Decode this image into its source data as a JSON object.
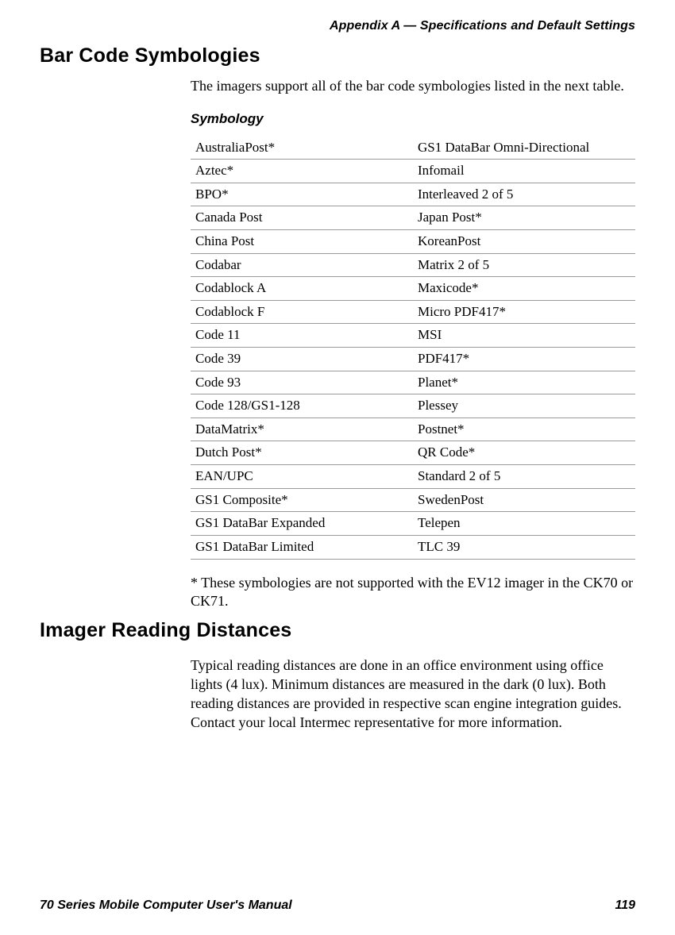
{
  "header": {
    "running_head": "Appendix A — Specifications and Default Settings"
  },
  "section1": {
    "heading": "Bar Code Symbologies",
    "intro": "The imagers support all of the bar code symbologies listed in the next table.",
    "table_caption": "Symbology",
    "rows": [
      {
        "left": "AustraliaPost*",
        "right": "GS1 DataBar Omni-Directional"
      },
      {
        "left": "Aztec*",
        "right": "Infomail"
      },
      {
        "left": "BPO*",
        "right": "Interleaved 2 of 5"
      },
      {
        "left": "Canada Post",
        "right": "Japan Post*"
      },
      {
        "left": "China Post",
        "right": "KoreanPost"
      },
      {
        "left": "Codabar",
        "right": "Matrix 2 of 5"
      },
      {
        "left": "Codablock A",
        "right": "Maxicode*"
      },
      {
        "left": "Codablock F",
        "right": "Micro PDF417*"
      },
      {
        "left": "Code 11",
        "right": "MSI"
      },
      {
        "left": "Code 39",
        "right": "PDF417*"
      },
      {
        "left": "Code 93",
        "right": "Planet*"
      },
      {
        "left": "Code 128/GS1-128",
        "right": "Plessey"
      },
      {
        "left": "DataMatrix*",
        "right": "Postnet*"
      },
      {
        "left": "Dutch Post*",
        "right": "QR Code*"
      },
      {
        "left": "EAN/UPC",
        "right": "Standard 2 of 5"
      },
      {
        "left": "GS1 Composite*",
        "right": "SwedenPost"
      },
      {
        "left": "GS1 DataBar Expanded",
        "right": "Telepen"
      },
      {
        "left": "GS1 DataBar Limited",
        "right": "TLC 39"
      }
    ],
    "footnote": "* These symbologies are not supported with the EV12 imager in the CK70 or CK71."
  },
  "section2": {
    "heading": "Imager Reading Distances",
    "body": "Typical reading distances are done in an office environment using office lights (4 lux). Minimum distances are measured in the dark (0 lux). Both reading distances are provided in respective scan engine integration guides. Contact your local Intermec representative for more information."
  },
  "footer": {
    "manual_title": "70 Series Mobile Computer User's Manual",
    "page_number": "119"
  }
}
